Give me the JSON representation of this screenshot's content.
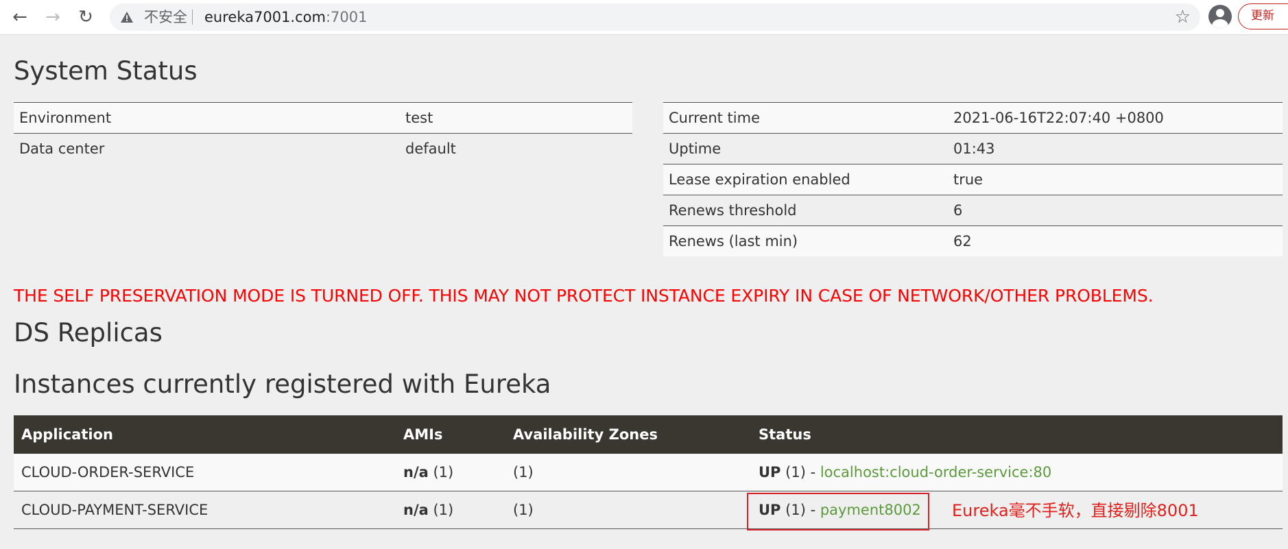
{
  "browser": {
    "back_icon": "←",
    "forward_icon": "→",
    "reload_icon": "↻",
    "insecure_label": "不安全",
    "url_host": "eureka7001.com",
    "url_port": ":7001",
    "bookmark_icon": "☆",
    "update_label": "更新"
  },
  "system_status": {
    "heading": "System Status",
    "left_table": [
      {
        "label": "Environment",
        "value": "test"
      },
      {
        "label": "Data center",
        "value": "default"
      }
    ],
    "right_table": [
      {
        "label": "Current time",
        "value": "2021-06-16T22:07:40 +0800"
      },
      {
        "label": "Uptime",
        "value": "01:43"
      },
      {
        "label": "Lease expiration enabled",
        "value": "true"
      },
      {
        "label": "Renews threshold",
        "value": "6"
      },
      {
        "label": "Renews (last min)",
        "value": "62"
      }
    ]
  },
  "warning": "THE SELF PRESERVATION MODE IS TURNED OFF. THIS MAY NOT PROTECT INSTANCE EXPIRY IN CASE OF NETWORK/OTHER PROBLEMS.",
  "ds_replicas": {
    "heading": "DS Replicas"
  },
  "instances": {
    "heading": "Instances currently registered with Eureka",
    "columns": [
      "Application",
      "AMIs",
      "Availability Zones",
      "Status"
    ],
    "rows": [
      {
        "application": "CLOUD-ORDER-SERVICE",
        "ami": "n/a",
        "ami_count": "(1)",
        "zones": "(1)",
        "status": "UP",
        "status_count": "(1) -",
        "instance": "localhost:cloud-order-service:80"
      },
      {
        "application": "CLOUD-PAYMENT-SERVICE",
        "ami": "n/a",
        "ami_count": "(1)",
        "zones": "(1)",
        "status": "UP",
        "status_count": "(1) -",
        "instance": "payment8002"
      }
    ]
  },
  "annotation": "Eureka毫不手软，直接剔除8001",
  "colors": {
    "warning": "#ff0000",
    "table_header": "#3a3630",
    "link": "#5b9a3a",
    "annotation": "#e0201a"
  }
}
